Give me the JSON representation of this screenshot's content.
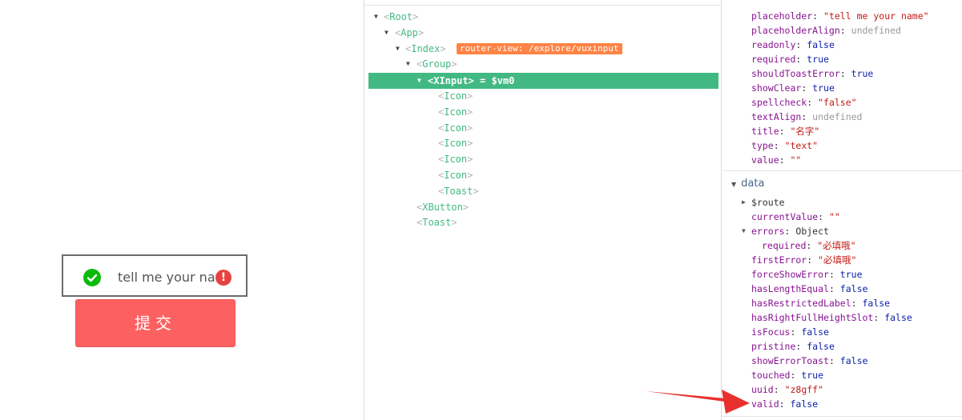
{
  "preview": {
    "input_text": "tell me your na",
    "error_icon_glyph": "!",
    "submit_label": "提交",
    "colors": {
      "check": "#09bb07",
      "error": "#e64340",
      "button": "#fd6060"
    }
  },
  "tree": {
    "nodes": [
      {
        "name": "Root"
      },
      {
        "name": "App"
      },
      {
        "name": "Index",
        "badge": "router-view: /explore/vuxinput"
      },
      {
        "name": "Group"
      },
      {
        "name": "XInput",
        "suffix": " = $vm0"
      },
      {
        "name": "Icon"
      },
      {
        "name": "Icon"
      },
      {
        "name": "Icon"
      },
      {
        "name": "Icon"
      },
      {
        "name": "Icon"
      },
      {
        "name": "Icon"
      },
      {
        "name": "Toast"
      },
      {
        "name": "XButton"
      },
      {
        "name": "Toast"
      }
    ]
  },
  "props": [
    {
      "key": "placeholder",
      "value": "\"tell me your name\"",
      "type": "string"
    },
    {
      "key": "placeholderAlign",
      "value": "undefined",
      "type": "undefined"
    },
    {
      "key": "readonly",
      "value": "false",
      "type": "bool"
    },
    {
      "key": "required",
      "value": "true",
      "type": "bool"
    },
    {
      "key": "shouldToastError",
      "value": "true",
      "type": "bool"
    },
    {
      "key": "showClear",
      "value": "true",
      "type": "bool"
    },
    {
      "key": "spellcheck",
      "value": "\"false\"",
      "type": "string"
    },
    {
      "key": "textAlign",
      "value": "undefined",
      "type": "undefined"
    },
    {
      "key": "title",
      "value": "\"名字\"",
      "type": "string"
    },
    {
      "key": "type",
      "value": "\"text\"",
      "type": "string"
    },
    {
      "key": "value",
      "value": "\"\"",
      "type": "string"
    }
  ],
  "data_section": {
    "label": "data",
    "items": [
      {
        "key": "$route",
        "value": "",
        "type": "obj"
      },
      {
        "key": "currentValue",
        "value": "\"\"",
        "type": "string"
      },
      {
        "key": "errors",
        "value": "Object",
        "type": "obj"
      },
      {
        "key": "required",
        "value": "\"必填哦\"",
        "type": "string"
      },
      {
        "key": "firstError",
        "value": "\"必填哦\"",
        "type": "string"
      },
      {
        "key": "forceShowError",
        "value": "true",
        "type": "bool"
      },
      {
        "key": "hasLengthEqual",
        "value": "false",
        "type": "bool"
      },
      {
        "key": "hasRestrictedLabel",
        "value": "false",
        "type": "bool"
      },
      {
        "key": "hasRightFullHeightSlot",
        "value": "false",
        "type": "bool"
      },
      {
        "key": "isFocus",
        "value": "false",
        "type": "bool"
      },
      {
        "key": "pristine",
        "value": "false",
        "type": "bool"
      },
      {
        "key": "showErrorToast",
        "value": "false",
        "type": "bool"
      },
      {
        "key": "touched",
        "value": "true",
        "type": "bool"
      },
      {
        "key": "uuid",
        "value": "\"z8gff\"",
        "type": "string"
      },
      {
        "key": "valid",
        "value": "false",
        "type": "bool"
      }
    ]
  },
  "colors": {
    "selected_row": "#42b983",
    "badge": "#ff8344",
    "annotation_arrow": "#e8312f"
  }
}
